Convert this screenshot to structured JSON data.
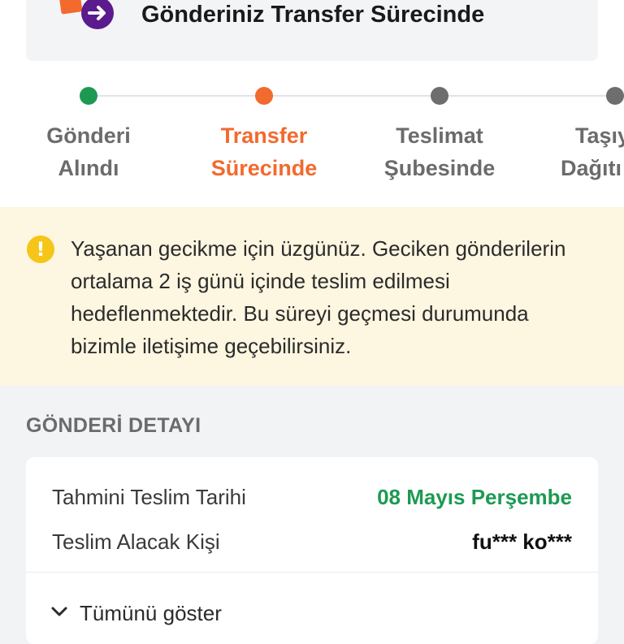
{
  "status": {
    "title": "Gönderiniz Transfer Sürecinde",
    "icon": "arrow-right-circle-icon",
    "icon_color": "#5b1a8e",
    "accent_color": "#f26a2e"
  },
  "stepper": {
    "steps": [
      {
        "line1": "Gönderi",
        "line2": "Alındı",
        "state": "done",
        "color": "#1d9a52"
      },
      {
        "line1": "Transfer",
        "line2": "Sürecinde",
        "state": "active",
        "color": "#f26a2e"
      },
      {
        "line1": "Teslimat",
        "line2": "Şubesinde",
        "state": "pending",
        "color": "#6e6e6e"
      },
      {
        "line1": "Taşıy",
        "line2": "Dağıtı",
        "state": "pending",
        "color": "#6e6e6e"
      }
    ]
  },
  "warning": {
    "icon": "exclamation-circle-icon",
    "text": "Yaşanan gecikme için üzgünüz. Geciken gönderilerin ortalama 2 iş günü içinde teslim edilmesi hedeflenmektedir. Bu süreyi geçmesi durumunda bizimle iletişime geçebilirsiniz."
  },
  "details": {
    "section_title": "GÖNDERİ DETAYI",
    "rows": [
      {
        "label": "Tahmini Teslim Tarihi",
        "value": "08 Mayıs Perşembe",
        "value_color": "#1d9a52"
      },
      {
        "label": "Teslim Alacak Kişi",
        "value": "fu*** ko***",
        "value_color": "#111111"
      }
    ],
    "expand_label": "Tümünü göster"
  }
}
